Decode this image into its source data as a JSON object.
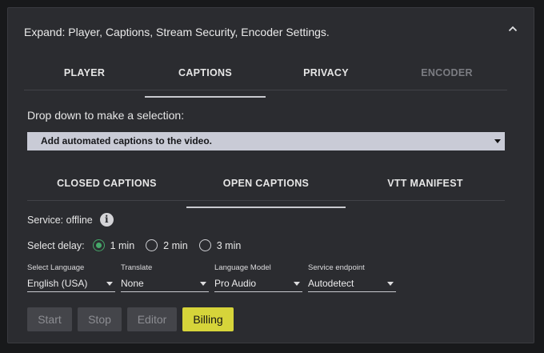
{
  "header": {
    "title": "Expand: Player, Captions, Stream Security, Encoder Settings."
  },
  "main_tabs": [
    {
      "label": "PLAYER",
      "state": "normal"
    },
    {
      "label": "CAPTIONS",
      "state": "active"
    },
    {
      "label": "PRIVACY",
      "state": "normal"
    },
    {
      "label": "ENCODER",
      "state": "disabled"
    }
  ],
  "dropdown": {
    "label": "Drop down to make a selection:",
    "selected": "Add automated captions to the video."
  },
  "sub_tabs": [
    {
      "label": "CLOSED CAPTIONS",
      "state": "normal"
    },
    {
      "label": "OPEN CAPTIONS",
      "state": "active"
    },
    {
      "label": "VTT MANIFEST",
      "state": "normal"
    }
  ],
  "service": {
    "status_text": "Service: offline",
    "info_glyph": "i"
  },
  "delay": {
    "label": "Select delay:",
    "options": [
      "1 min",
      "2 min",
      "3 min"
    ],
    "selected_index": 0
  },
  "fields": [
    {
      "label": "Select Language",
      "value": "English (USA)"
    },
    {
      "label": "Translate",
      "value": "None"
    },
    {
      "label": "Language Model",
      "value": "Pro Audio"
    },
    {
      "label": "Service endpoint",
      "value": "Autodetect"
    }
  ],
  "buttons": [
    {
      "label": "Start",
      "state": "disabled"
    },
    {
      "label": "Stop",
      "state": "disabled"
    },
    {
      "label": "Editor",
      "state": "disabled"
    },
    {
      "label": "Billing",
      "state": "primary"
    }
  ],
  "colors": {
    "background": "#18191b",
    "panel": "#2b2c30",
    "accent_yellow": "#d6d43a",
    "radio_green": "#46a86a",
    "select_bg": "#c9cbd6"
  },
  "icons": {
    "collapse": "chevron-up-icon",
    "info": "info-icon",
    "dropdown": "caret-down-icon"
  }
}
